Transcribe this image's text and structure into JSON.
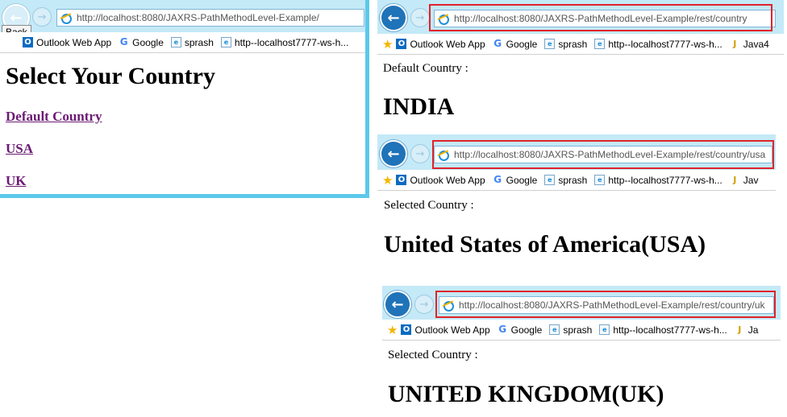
{
  "left_window": {
    "address": "http://localhost:8080/JAXRS-PathMethodLevel-Example/",
    "address_host": "localhost",
    "back_tooltip": "Back",
    "favorites": [
      "Outlook Web App",
      "Google",
      "sprash",
      "http--localhost7777-ws-h..."
    ],
    "heading": "Select Your Country",
    "links": [
      "Default Country",
      "USA",
      "UK"
    ]
  },
  "right_windows": [
    {
      "address": "http://localhost:8080/JAXRS-PathMethodLevel-Example/rest/country",
      "favorites": [
        "Outlook Web App",
        "Google",
        "sprash",
        "http--localhost7777-ws-h...",
        "Java4"
      ],
      "label": "Default Country :",
      "country": "INDIA"
    },
    {
      "address": "http://localhost:8080/JAXRS-PathMethodLevel-Example/rest/country/usa",
      "favorites": [
        "Outlook Web App",
        "Google",
        "sprash",
        "http--localhost7777-ws-h...",
        "Jav"
      ],
      "label": "Selected Country :",
      "country": "United States of America(USA)"
    },
    {
      "address": "http://localhost:8080/JAXRS-PathMethodLevel-Example/rest/country/uk",
      "favorites": [
        "Outlook Web App",
        "Google",
        "sprash",
        "http--localhost7777-ws-h...",
        "Ja"
      ],
      "label": "Selected Country :",
      "country": "UNITED KINGDOM(UK)"
    }
  ],
  "colors": {
    "chrome": "#c4e9f7",
    "highlight_box": "#e0232b",
    "visited_link": "#6b1b74",
    "window_border": "#5bc8ea"
  }
}
